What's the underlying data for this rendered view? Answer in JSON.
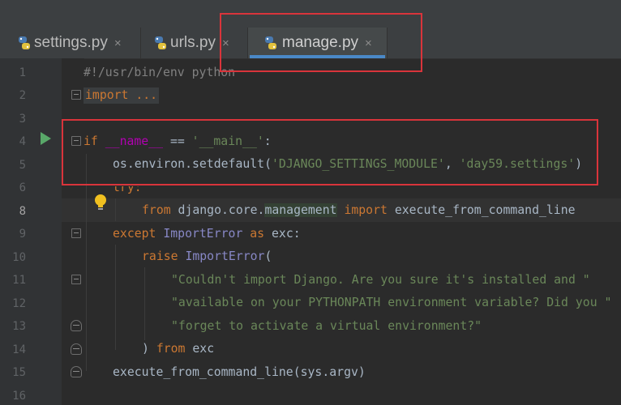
{
  "tabs": [
    {
      "label": "settings.py",
      "icon": "python-file-icon",
      "active": false
    },
    {
      "label": "urls.py",
      "icon": "python-file-icon",
      "active": false
    },
    {
      "label": "manage.py",
      "icon": "python-file-icon",
      "active": true
    }
  ],
  "close_glyph": "×",
  "editor": {
    "current_line": 8,
    "line_numbers": [
      "1",
      "2",
      "3",
      "4",
      "5",
      "6",
      "7",
      "8",
      "9",
      "10",
      "11",
      "12",
      "13",
      "14",
      "15",
      "16"
    ],
    "lines": {
      "l1": "#!/usr/bin/env python",
      "l2": "import ...",
      "l5_kw": "if",
      "l5_name": "__name__",
      "l5_eq": " == ",
      "l5_str": "'__main__'",
      "l5_colon": ":",
      "l6_obj": "os.environ.setdefault(",
      "l6_arg1": "'DJANGO_SETTINGS_MODULE'",
      "l6_sep": ", ",
      "l6_arg2": "'day59.settings'",
      "l6_close": ")",
      "l7": "try:",
      "l8_kw1": "from",
      "l8_mod1": " django.core.",
      "l8_mod2": "management",
      "l8_kw2": " import",
      "l8_rest": " execute_from_command_line",
      "l9_kw": "except",
      "l9_cls": " ImportError",
      "l9_as": " as",
      "l9_rest": " exc:",
      "l10_kw": "raise",
      "l10_cls": " ImportError",
      "l10_rest": "(",
      "l11": "\"Couldn't import Django. Are you sure it's installed and \"",
      "l12": "\"available on your PYTHONPATH environment variable? Did you \"",
      "l13": "\"forget to activate a virtual environment?\"",
      "l14_paren": ") ",
      "l14_kw": "from",
      "l14_rest": " exc",
      "l15": "execute_from_command_line(sys.argv)"
    }
  },
  "colors": {
    "background": "#2b2b2b",
    "keyword": "#cc7832",
    "string": "#6a8759",
    "comment": "#808080",
    "annotation_box": "#d9343b",
    "active_tab_underline": "#4a88c7"
  },
  "icons": {
    "run": "run-arrow-icon",
    "intention": "lightbulb-icon",
    "fold": "fold-icon"
  }
}
